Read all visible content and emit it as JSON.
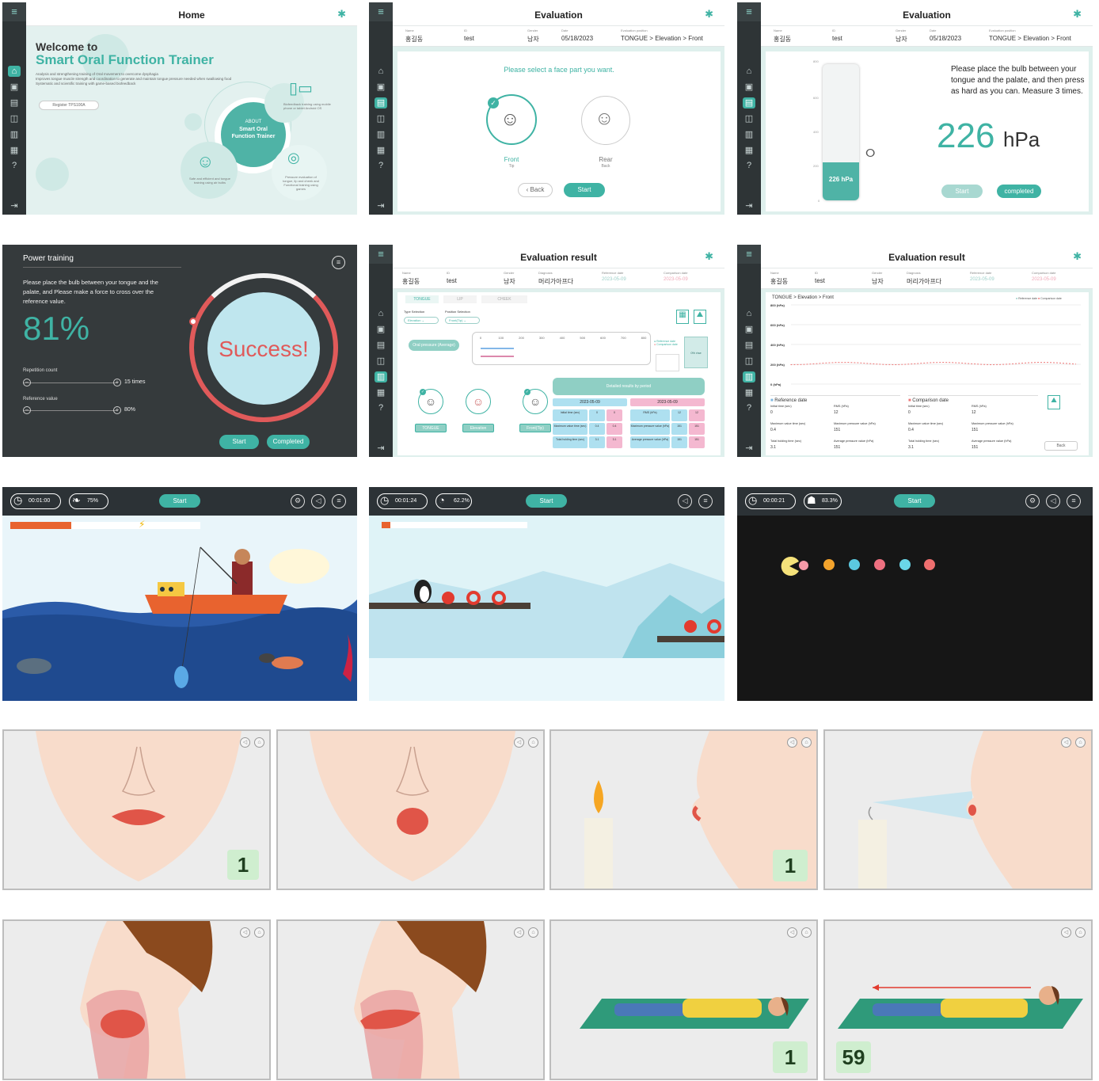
{
  "home": {
    "title": "Home",
    "welcome": "Welcome to",
    "product": "Smart Oral Function Trainer",
    "desc1": "Analysis and strengthening training of Oral movement to overcome dysphagia",
    "desc2": "Improves tongue muscle strength and coordination to generate and maintain tongue pressure needed when swallowing food",
    "desc3": "Systematic and scientific training with game-based biofeedback",
    "register": "Register TPS100A",
    "about_label": "ABOUT",
    "about_name": "Smart Oral Function Trainer",
    "feat1": "Biofeedback training using mobile phone or tablet Android OS",
    "feat2": "Safe and efficient and tongue training using air bulbs",
    "feat3": "Pressure evaluation of tongue, lip and cheek and Functional training using games"
  },
  "patient": {
    "name_label": "Name",
    "name": "홍길동",
    "id_label": "ID",
    "id": "test",
    "gender_label": "Gender",
    "gender": "남자",
    "date_label": "Date",
    "date": "05/18/2023",
    "position_label": "Evaluation position",
    "position": "TONGUE > Elevation > Front",
    "diagnosis_label": "Diagnosis",
    "diagnosis": "머리가아프다",
    "ref_label": "Reference date",
    "ref_date": "2023-05-09",
    "cmp_label": "Comparison date",
    "cmp_date": "2023-05-09"
  },
  "eval_select": {
    "title": "Evaluation",
    "prompt": "Please select a face part you want.",
    "front": "Front",
    "front_sub": "Tip",
    "rear": "Rear",
    "rear_sub": "Back",
    "back_btn": "Back",
    "start_btn": "Start"
  },
  "eval_measure": {
    "title": "Evaluation",
    "instruction": "Please place the bulb between your tongue and the palate, and then press as hard as you can. Measure 3 times.",
    "value": "226",
    "unit": "hPa",
    "bar_label": "226 hPa",
    "ticks": [
      "800",
      "600",
      "400",
      "200",
      "0"
    ],
    "bar_fraction": 0.28,
    "start_btn": "Start",
    "completed_btn": "completed"
  },
  "power": {
    "title": "Power training",
    "instruction": "Please place the bulb between your tongue and the palate, and Please make a force to cross over the reference value.",
    "percent": "81%",
    "rep_label": "Repetition count",
    "rep_value": "15 times",
    "ref_label": "Reference value",
    "ref_value": "80%",
    "success": "Success!",
    "start_btn": "Start",
    "completed_btn": "Completed"
  },
  "result1": {
    "title": "Evaluation result",
    "tabs": [
      "TONGUE",
      "LIP",
      "CHEEK"
    ],
    "type_label": "Type Selection",
    "type_value": "Elevation",
    "pos_label": "Position Selection",
    "pos_value": "Front(Tip)",
    "oral_btn": "Oral pressure (Average)",
    "axis": [
      "0",
      "100",
      "200",
      "300",
      "400",
      "500",
      "600",
      "700",
      "800"
    ],
    "legend_ref": "Reference date",
    "legend_cmp": "Comparison date",
    "pct_box": "0% rise",
    "detailed": "Detailed results by period",
    "parts": [
      "TONGUE",
      "Elevation",
      "Front(Tip)"
    ],
    "col_ref": "2023-05-09",
    "col_cmp": "2023-05-09",
    "rows": [
      {
        "l1": "Initial time (sec)",
        "a": "0",
        "b": "0",
        "l2": "RMS (hPa)",
        "c": "12",
        "d": "12"
      },
      {
        "l1": "Maximum value time (sec)",
        "a": "0.4",
        "b": "0.4",
        "l2": "Maximum pressure value (hPa)",
        "c": "151",
        "d": "151"
      },
      {
        "l1": "Total holding time (sec)",
        "a": "3.1",
        "b": "3.1",
        "l2": "Average pressure value (hPa)",
        "c": "151",
        "d": "151"
      }
    ]
  },
  "result2": {
    "title": "Evaluation result",
    "path": "TONGUE > Elevation > Front",
    "legend_ref": "Reference date",
    "legend_cmp": "Comparison date",
    "yticks": [
      "800 (hPa)",
      "600 (hPa)",
      "400 (hPa)",
      "200 (hPa)",
      "0 (hPa)"
    ],
    "ref_title": "Reference date",
    "cmp_title": "Comparison date",
    "fields": [
      {
        "k": "Initial time (sec)",
        "v": "0",
        "k2": "RMS (hPa)",
        "v2": "12"
      },
      {
        "k": "Maximum value time (sec)",
        "v": "0.4",
        "k2": "Maximum pressure value (hPa)",
        "v2": "151"
      },
      {
        "k": "Total holding time (sec)",
        "v": "3.1",
        "k2": "Average pressure value (hPa)",
        "v2": "151"
      }
    ],
    "back_btn": "Back"
  },
  "games": [
    {
      "time": "00:01:00",
      "pct": "75%",
      "start": "Start",
      "progress": 0.32
    },
    {
      "time": "00:01:24",
      "pct": "62.2%",
      "start": "Start",
      "progress": 0.06
    },
    {
      "time": "00:00:21",
      "pct": "83.3%",
      "start": "Start"
    }
  ],
  "exercises": {
    "badges": [
      "1",
      "1",
      "1",
      "59"
    ]
  },
  "colors": {
    "teal": "#3fb3a4",
    "dark": "#2e3436",
    "red": "#e05a5a"
  }
}
